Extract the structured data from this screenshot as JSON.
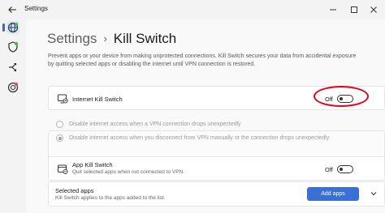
{
  "app": {
    "title": "Settings"
  },
  "breadcrumb": {
    "parent": "Settings",
    "separator": "›",
    "current": "Kill Switch"
  },
  "description": "Prevent apps or your device from making unprotected connections. Kill Switch secures your data from accidental exposure by quitting selected apps or disabling the internet until VPN connection is restored.",
  "sidebar": {
    "items": [
      {
        "icon": "globe-icon",
        "active": true
      },
      {
        "icon": "shield-icon",
        "active": false
      },
      {
        "icon": "split-arrows-icon",
        "active": false
      },
      {
        "icon": "target-icon",
        "active": false
      }
    ]
  },
  "internet_kill_switch": {
    "label": "Internet Kill Switch",
    "state_text": "Off",
    "enabled": false,
    "options": [
      {
        "label": "Disable internet access when a VPN connection drops unexpectedly",
        "checked": false
      },
      {
        "label": "Disable internet access when you disconnect from VPN manually or the connection drops unexpectedly",
        "checked": true
      }
    ]
  },
  "app_kill_switch": {
    "label": "App Kill Switch",
    "sublabel": "Quit selected apps when not connected to VPN.",
    "state_text": "Off",
    "enabled": false
  },
  "selected_apps": {
    "label": "Selected apps",
    "sublabel": "Kill Switch applies to the apps added to the list.",
    "button": "Add apps"
  },
  "colors": {
    "accent": "#3b6fd8",
    "highlight": "#e3001b",
    "active_nav": "#3a66c4"
  }
}
